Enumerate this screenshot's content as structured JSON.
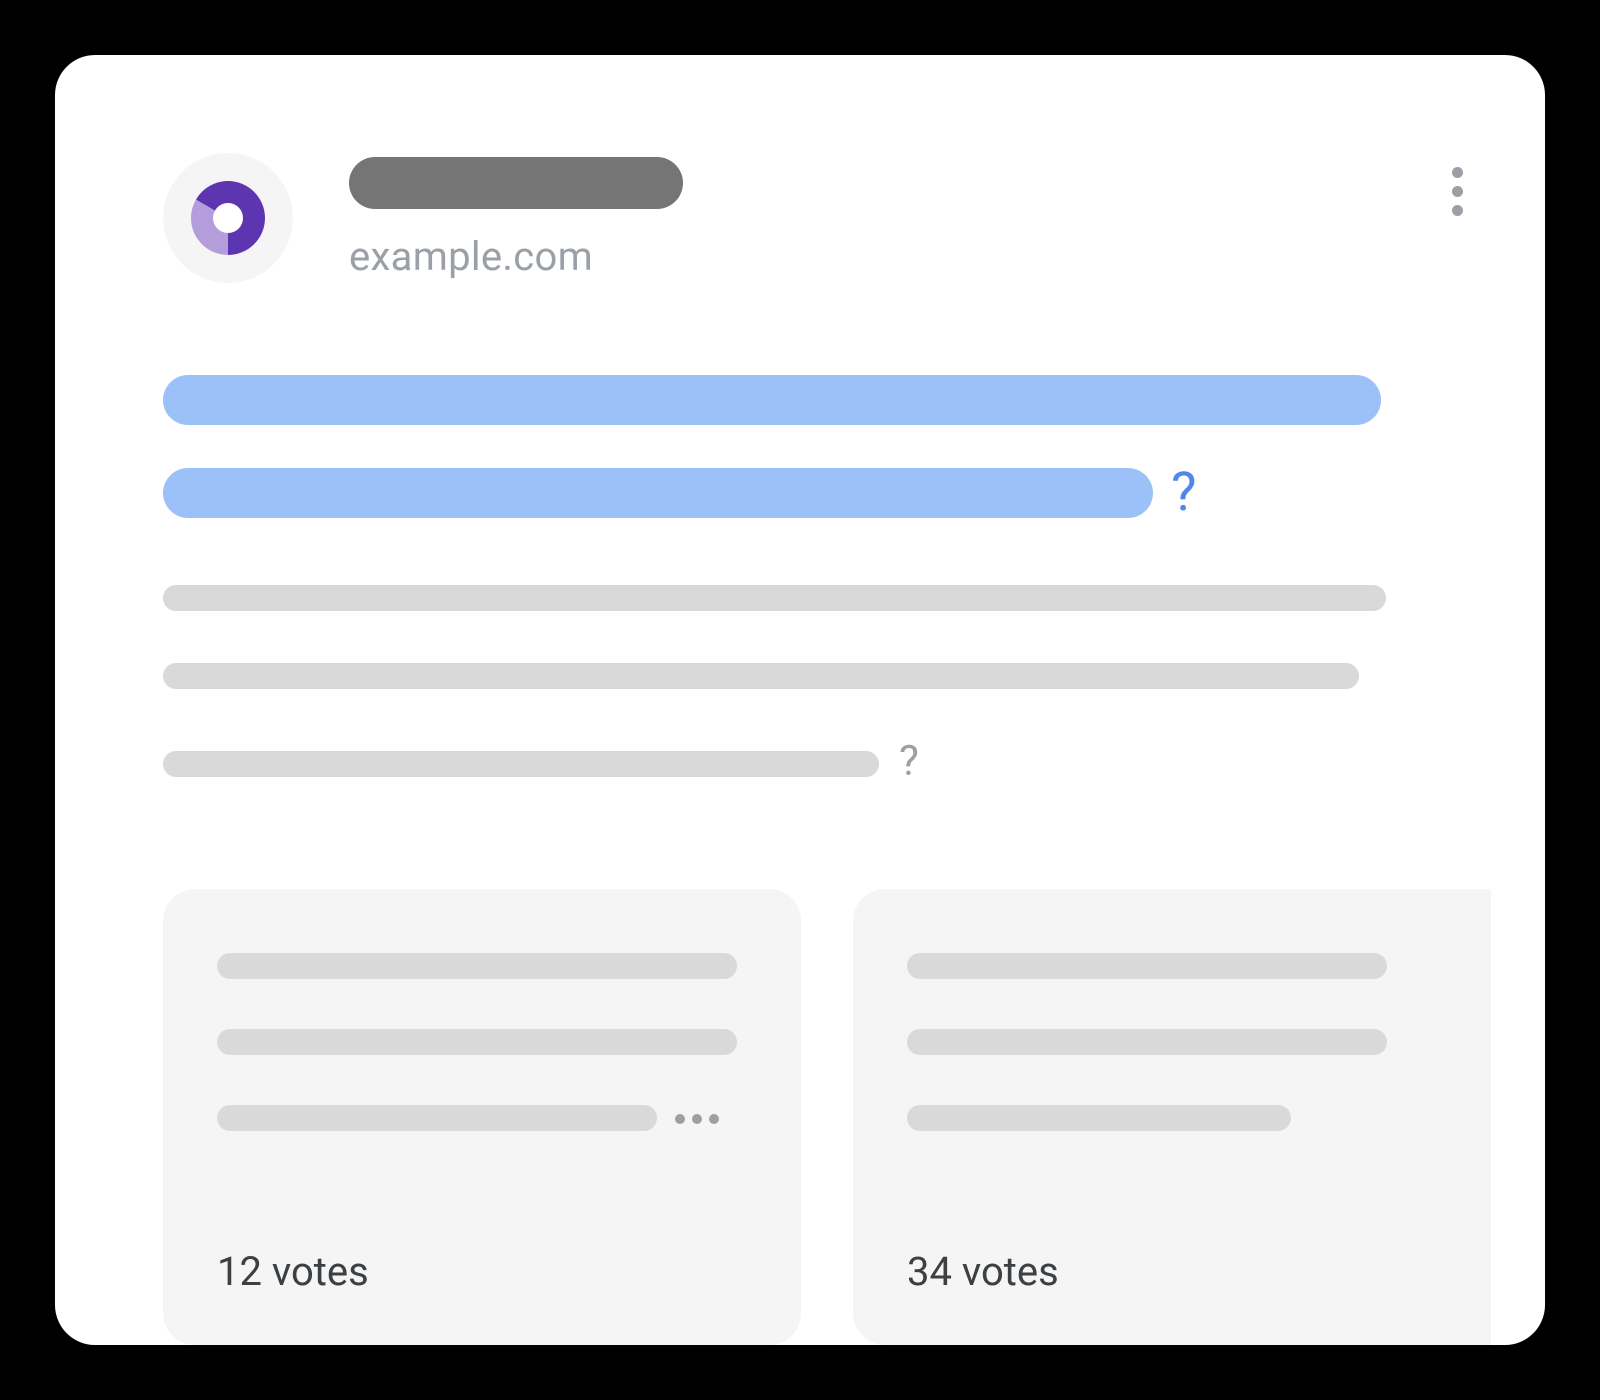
{
  "header": {
    "domain": "example.com"
  },
  "title": {
    "question_mark": "?"
  },
  "description": {
    "question_mark": "?"
  },
  "cards": [
    {
      "votes": "12 votes"
    },
    {
      "votes": "34 votes"
    }
  ]
}
